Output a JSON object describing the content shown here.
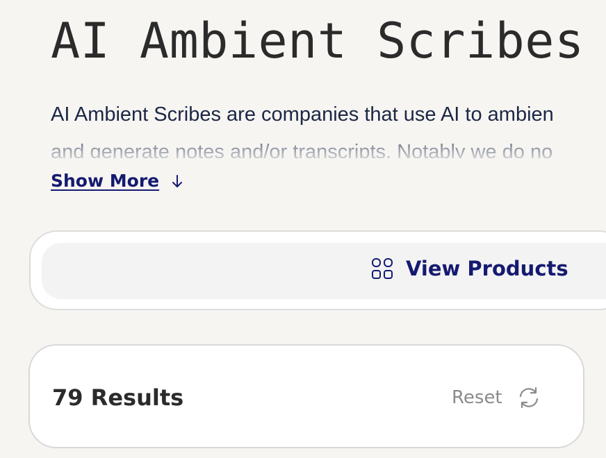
{
  "page": {
    "title": "AI Ambient Scribes",
    "description_line1": "AI Ambient Scribes are companies that use AI to ambien",
    "description_line2": "and generate notes and/or transcripts. Notably we do no"
  },
  "show_more": {
    "label": "Show More",
    "icon": "arrow-down-icon"
  },
  "view_products": {
    "label": "View Products",
    "icon": "grid-icon"
  },
  "results": {
    "count_label": "79 Results",
    "reset_label": "Reset",
    "reset_icon": "refresh-icon"
  },
  "colors": {
    "page_background": "#f6f5f2",
    "title_text": "#2b2b2b",
    "accent": "#151a70",
    "muted_text": "#8b8b8b",
    "card_border": "#d8d8d8"
  }
}
